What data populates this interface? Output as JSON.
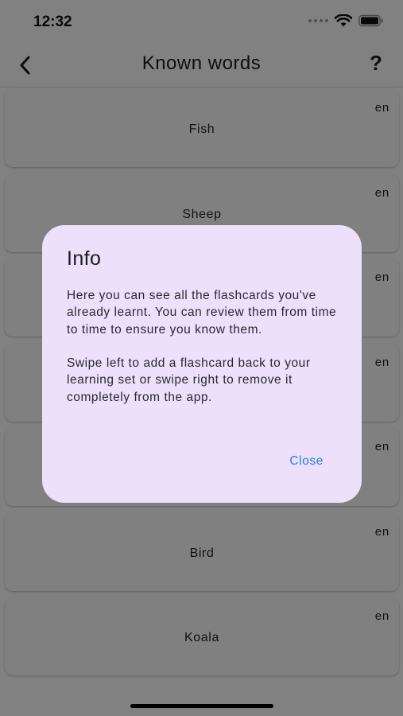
{
  "status_bar": {
    "time": "12:32"
  },
  "nav": {
    "title": "Known words",
    "help_label": "?"
  },
  "cards": [
    {
      "word": "Fish",
      "lang": "en"
    },
    {
      "word": "Sheep",
      "lang": "en"
    },
    {
      "word": "",
      "lang": "en"
    },
    {
      "word": "",
      "lang": "en"
    },
    {
      "word": "",
      "lang": "en"
    },
    {
      "word": "Bird",
      "lang": "en"
    },
    {
      "word": "Koala",
      "lang": "en"
    }
  ],
  "dialog": {
    "title": "Info",
    "paragraph_1": "Here you can see all the flashcards you've already learnt. You can review them from time to time to ensure you know them.",
    "paragraph_2": "Swipe left to add a flashcard back to your learning set or swipe right to remove it completely from the app.",
    "close_label": "Close"
  },
  "colors": {
    "dialog_background": "#ece0fb",
    "close_button": "#2d7be5",
    "scrim": "rgba(0,0,0,0.48)"
  },
  "icons": {
    "back": "chevron-left-icon",
    "wifi": "wifi-icon",
    "battery": "battery-icon",
    "signal": "signal-dots-icon"
  }
}
